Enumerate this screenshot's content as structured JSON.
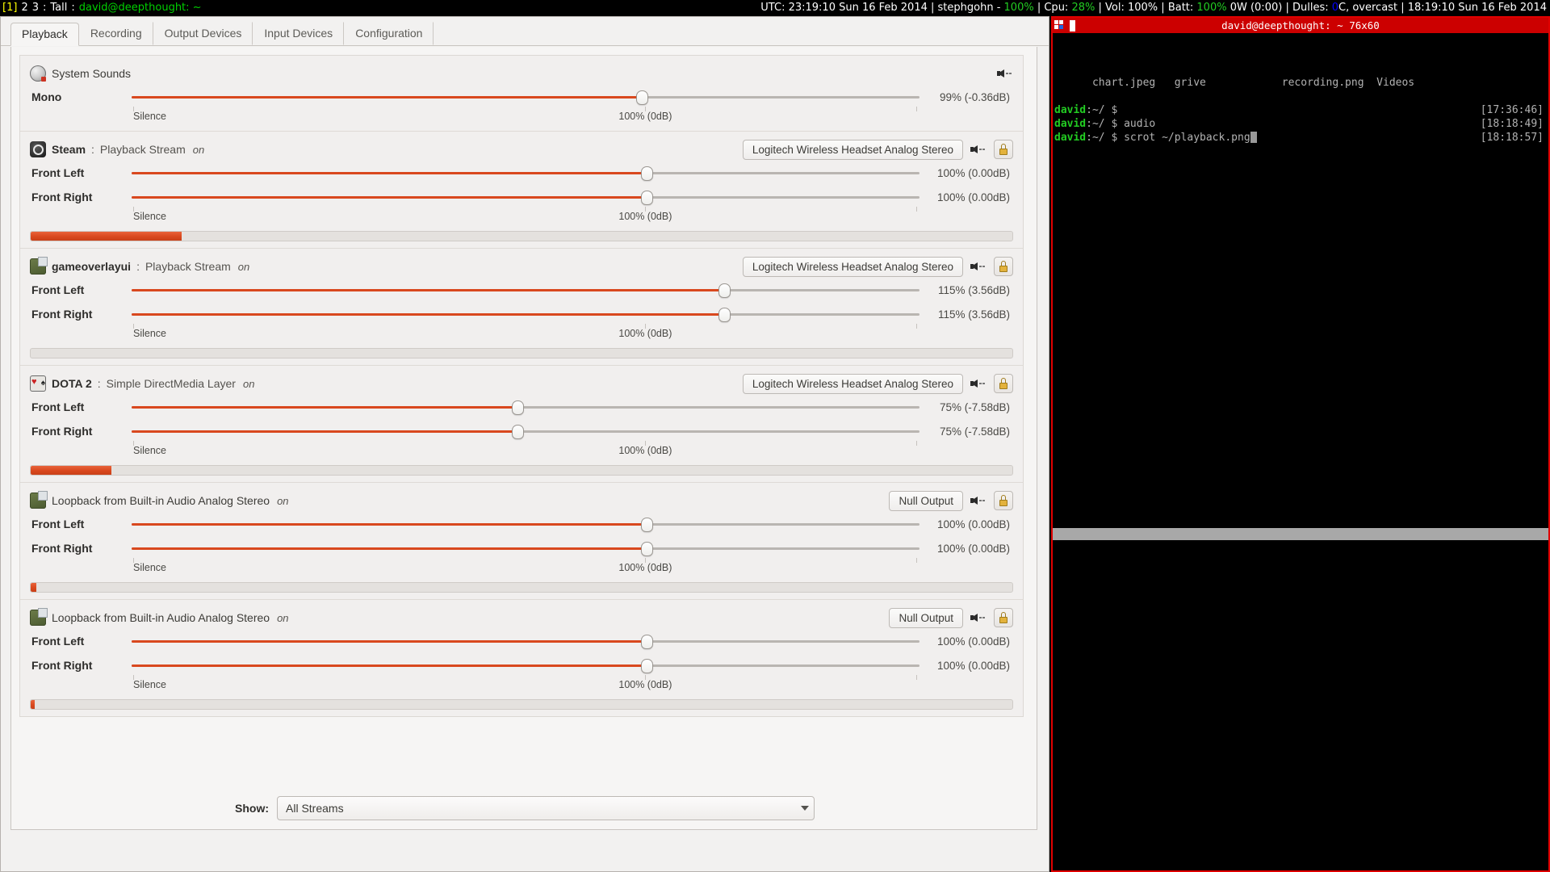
{
  "statusbar": {
    "tags": [
      "1",
      "2",
      "3"
    ],
    "selected_tag": "1",
    "layout": "Tall",
    "window_title": "david@deepthought: ~",
    "sep": ":",
    "right": {
      "utc_label": "UTC: 23:19:10 Sun 16 Feb 2014",
      "user_label": "stephgohn - ",
      "user_value": "100%",
      "cpu_label": "Cpu: ",
      "cpu_value": "28%",
      "vol_label": "Vol: 100%",
      "batt_label": "Batt: ",
      "batt_value": "100%",
      "batt_rest": " 0W (0:00)",
      "weather_label": "Dulles: ",
      "weather_value": "0",
      "weather_rest": "C, overcast",
      "local_time": "18:19:10 Sun 16 Feb 2014",
      "pipe": "|"
    }
  },
  "pavucontrol": {
    "tabs": [
      {
        "label": "Playback",
        "active": true
      },
      {
        "label": "Recording",
        "active": false
      },
      {
        "label": "Output Devices",
        "active": false
      },
      {
        "label": "Input Devices",
        "active": false
      },
      {
        "label": "Configuration",
        "active": false
      }
    ],
    "scale": {
      "left_label": "Silence",
      "right_label": "100% (0dB)"
    },
    "streams": [
      {
        "icon": "system-sounds-icon",
        "icon_class": "sys",
        "name": "System Sounds",
        "name_bold": false,
        "colon": "",
        "subtitle": "",
        "on": "",
        "device": null,
        "has_lock": false,
        "channels": [
          {
            "label": "Mono",
            "value": "99% (-0.36dB)",
            "pct": 99
          }
        ],
        "meter": null
      },
      {
        "icon": "steam-icon",
        "icon_class": "steam",
        "name": "Steam",
        "name_bold": true,
        "colon": ":",
        "subtitle": "Playback Stream",
        "on": "on",
        "device": "Logitech Wireless Headset Analog Stereo",
        "has_lock": true,
        "channels": [
          {
            "label": "Front Left",
            "value": "100% (0.00dB)",
            "pct": 100
          },
          {
            "label": "Front Right",
            "value": "100% (0.00dB)",
            "pct": 100
          }
        ],
        "meter": 15.4
      },
      {
        "icon": "gameoverlayui-icon",
        "icon_class": "overlay",
        "name": "gameoverlayui",
        "name_bold": true,
        "colon": ":",
        "subtitle": "Playback Stream",
        "on": "on",
        "device": "Logitech Wireless Headset Analog Stereo",
        "has_lock": true,
        "channels": [
          {
            "label": "Front Left",
            "value": "115% (3.56dB)",
            "pct": 115
          },
          {
            "label": "Front Right",
            "value": "115% (3.56dB)",
            "pct": 115
          }
        ],
        "meter": 0
      },
      {
        "icon": "dota2-icon",
        "icon_class": "dota",
        "name": "DOTA 2",
        "name_bold": true,
        "colon": ":",
        "subtitle": "Simple DirectMedia Layer",
        "on": "on",
        "device": "Logitech Wireless Headset Analog Stereo",
        "has_lock": true,
        "channels": [
          {
            "label": "Front Left",
            "value": "75% (-7.58dB)",
            "pct": 75
          },
          {
            "label": "Front Right",
            "value": "75% (-7.58dB)",
            "pct": 75
          }
        ],
        "meter": 8.2
      },
      {
        "icon": "loopback-icon",
        "icon_class": "loopback",
        "name": "Loopback from Built-in Audio Analog Stereo",
        "name_bold": false,
        "colon": "",
        "subtitle": "",
        "on": "on",
        "device": "Null Output",
        "has_lock": true,
        "channels": [
          {
            "label": "Front Left",
            "value": "100% (0.00dB)",
            "pct": 100
          },
          {
            "label": "Front Right",
            "value": "100% (0.00dB)",
            "pct": 100
          }
        ],
        "meter": 0.6
      },
      {
        "icon": "loopback-icon",
        "icon_class": "loopback",
        "name": "Loopback from Built-in Audio Analog Stereo",
        "name_bold": false,
        "colon": "",
        "subtitle": "",
        "on": "on",
        "device": "Null Output",
        "has_lock": true,
        "channels": [
          {
            "label": "Front Left",
            "value": "100% (0.00dB)",
            "pct": 100
          },
          {
            "label": "Front Right",
            "value": "100% (0.00dB)",
            "pct": 100
          }
        ],
        "meter": 0.4
      }
    ],
    "footer": {
      "show_label": "Show:",
      "show_value": "All Streams"
    }
  },
  "terminal": {
    "title": "david@deepthought: ~ 76x60",
    "ls_output": "chart.jpeg   grive            recording.png  Videos",
    "lines": [
      {
        "user": "david",
        "path": ":~/ $",
        "cmd": "",
        "ts": "[17:36:46]",
        "cursor": false
      },
      {
        "user": "david",
        "path": ":~/ $",
        "cmd": " audio",
        "ts": "[18:18:49]",
        "cursor": false
      },
      {
        "user": "david",
        "path": ":~/ $",
        "cmd": " scrot ~/playback.png",
        "ts": "[18:18:57]",
        "cursor": true
      }
    ]
  },
  "colors": {
    "accent_orange": "#d9481e",
    "terminal_red": "#cc0000",
    "status_green": "#22cc22",
    "status_blue": "#0000ff"
  }
}
